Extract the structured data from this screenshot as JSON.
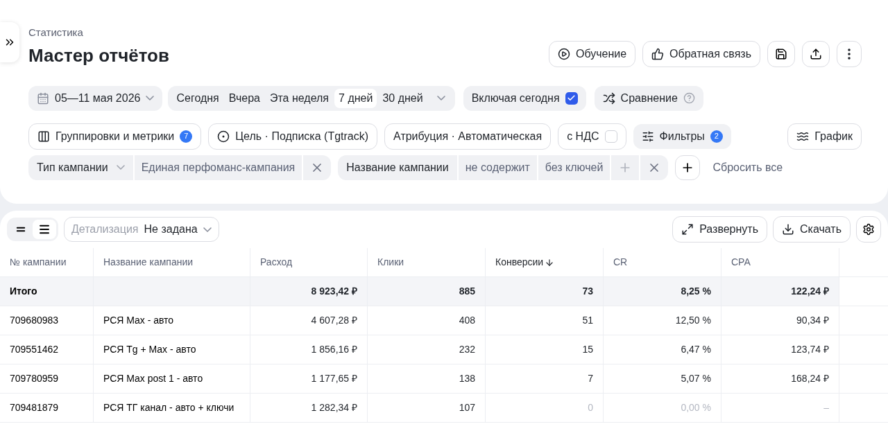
{
  "breadcrumb": "Статистика",
  "title": "Мастер отчётов",
  "learn_button": "Обучение",
  "feedback_button": "Обратная связь",
  "date_range": "05—11 мая 2026",
  "periods": [
    {
      "label": "Сегодня",
      "selected": false
    },
    {
      "label": "Вчера",
      "selected": false
    },
    {
      "label": "Эта неделя",
      "selected": false
    },
    {
      "label": "7 дней",
      "selected": true
    },
    {
      "label": "30 дней",
      "selected": false
    }
  ],
  "include_today": {
    "label": "Включая сегодня",
    "checked": true
  },
  "comparison": "Сравнение",
  "groupings": {
    "label": "Группировки и метрики",
    "count": "7"
  },
  "goal": "Цель · Подписка (Tgtrack)",
  "attribution": "Атрибуция · Автоматическая",
  "vat": {
    "label": "с НДС",
    "checked": false
  },
  "filters_button": {
    "label": "Фильтры",
    "count": "2"
  },
  "chart_button": "График",
  "filters": [
    {
      "kind": "select",
      "field": "Тип кампании",
      "parts": [
        "Единая перфоманс-кампания"
      ]
    },
    {
      "kind": "text",
      "field": "Название кампании",
      "parts": [
        "не содержит",
        "без ключей"
      ]
    }
  ],
  "reset": "Сбросить все",
  "view_modes": [
    {
      "selected": false
    },
    {
      "selected": true
    }
  ],
  "detail": {
    "label": "Детализация",
    "value": "Не задана"
  },
  "expand_button": "Развернуть",
  "download_button": "Скачать",
  "table": {
    "columns": [
      {
        "label": "№ кампании",
        "sorted": false
      },
      {
        "label": "Название кампании",
        "sorted": false
      },
      {
        "label": "Расход",
        "sorted": false
      },
      {
        "label": "Клики",
        "sorted": false
      },
      {
        "label": "Конверсии",
        "sorted": true
      },
      {
        "label": "CR",
        "sorted": false
      },
      {
        "label": "CPA",
        "sorted": false
      }
    ],
    "rows": [
      {
        "kind": "total",
        "label": "Итого",
        "values": [
          {
            "text": "8 923,42 ₽",
            "muted": false
          },
          {
            "text": "885",
            "muted": false
          },
          {
            "text": "73",
            "muted": false
          },
          {
            "text": "8,25 %",
            "muted": false
          },
          {
            "text": "122,24 ₽",
            "muted": false
          }
        ]
      },
      {
        "kind": "data",
        "id": "709680983",
        "name": "РСЯ Max - авто",
        "values": [
          {
            "text": "4 607,28 ₽",
            "muted": false
          },
          {
            "text": "408",
            "muted": false
          },
          {
            "text": "51",
            "muted": false
          },
          {
            "text": "12,50 %",
            "muted": false
          },
          {
            "text": "90,34 ₽",
            "muted": false
          }
        ]
      },
      {
        "kind": "data",
        "id": "709551462",
        "name": "РСЯ Tg + Max - авто",
        "values": [
          {
            "text": "1 856,16 ₽",
            "muted": false
          },
          {
            "text": "232",
            "muted": false
          },
          {
            "text": "15",
            "muted": false
          },
          {
            "text": "6,47 %",
            "muted": false
          },
          {
            "text": "123,74 ₽",
            "muted": false
          }
        ]
      },
      {
        "kind": "data",
        "id": "709780959",
        "name": "РСЯ Max post 1 - авто",
        "values": [
          {
            "text": "1 177,65 ₽",
            "muted": false
          },
          {
            "text": "138",
            "muted": false
          },
          {
            "text": "7",
            "muted": false
          },
          {
            "text": "5,07 %",
            "muted": false
          },
          {
            "text": "168,24 ₽",
            "muted": false
          }
        ]
      },
      {
        "kind": "data",
        "id": "709481879",
        "name": "РСЯ ТГ канал - авто + ключи",
        "values": [
          {
            "text": "1 282,34 ₽",
            "muted": false
          },
          {
            "text": "107",
            "muted": false
          },
          {
            "text": "0",
            "muted": true
          },
          {
            "text": "0,00 %",
            "muted": true
          },
          {
            "text": "–",
            "muted": true
          }
        ]
      }
    ]
  }
}
